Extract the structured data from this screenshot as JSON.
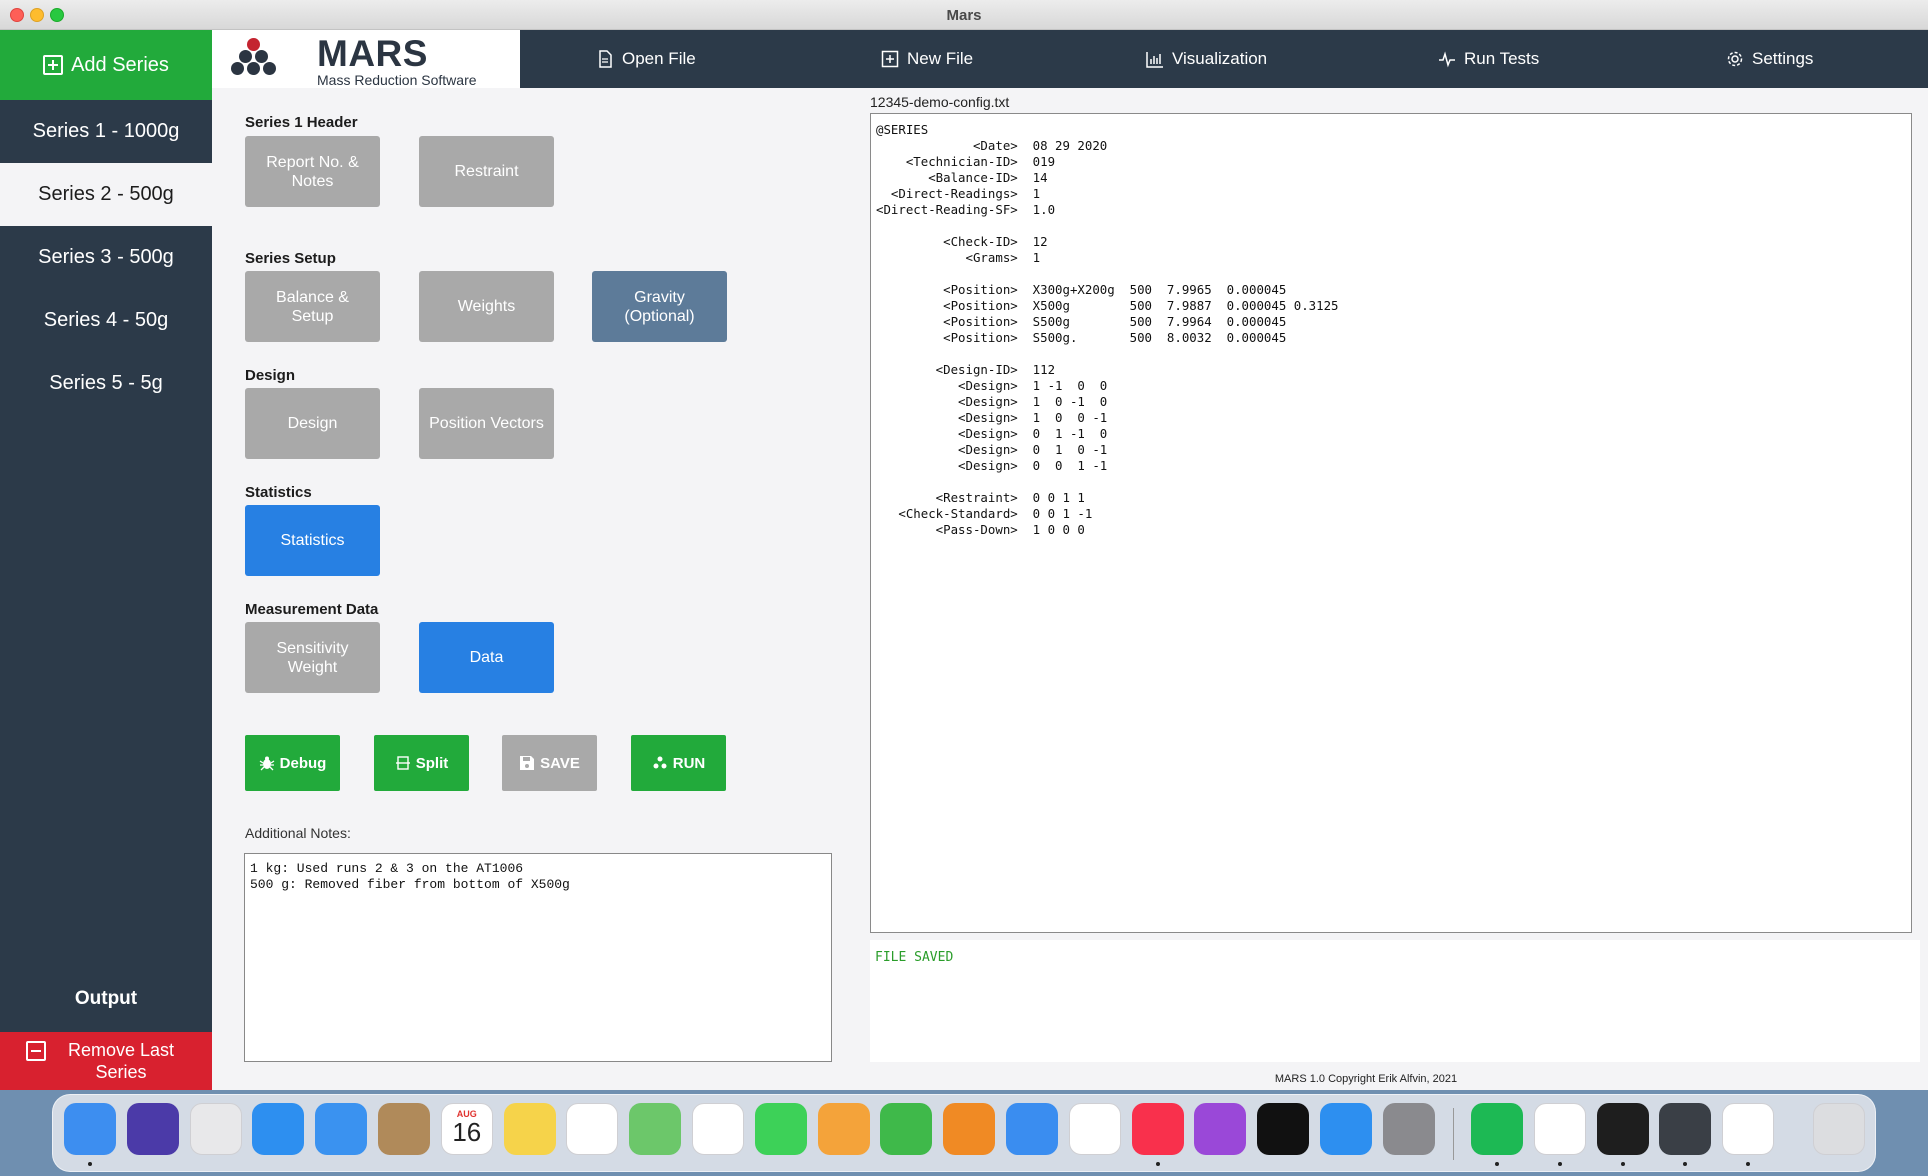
{
  "window": {
    "title": "Mars"
  },
  "sidebar": {
    "add_series_label": "Add Series",
    "items": [
      {
        "label": "Series 1 - 1000g",
        "active": false
      },
      {
        "label": "Series 2 - 500g",
        "active": true
      },
      {
        "label": "Series 3 - 500g",
        "active": false
      },
      {
        "label": "Series 4 - 50g",
        "active": false
      },
      {
        "label": "Series 5 - 5g",
        "active": false
      }
    ],
    "output_label": "Output",
    "remove_label": "Remove Last Series"
  },
  "logo": {
    "title": "MARS",
    "subtitle": "Mass Reduction Software"
  },
  "nav": {
    "open_file": "Open File",
    "new_file": "New File",
    "visualization": "Visualization",
    "run_tests": "Run Tests",
    "settings": "Settings"
  },
  "sections": {
    "header": {
      "title": "Series 1 Header",
      "report": "Report No. & Notes",
      "restraint": "Restraint"
    },
    "setup": {
      "title": "Series Setup",
      "balance": "Balance & Setup",
      "weights": "Weights",
      "gravity": "Gravity (Optional)"
    },
    "design": {
      "title": "Design",
      "design": "Design",
      "position_vectors": "Position Vectors"
    },
    "statistics": {
      "title": "Statistics",
      "statistics": "Statistics"
    },
    "measurement": {
      "title": "Measurement Data",
      "sensitivity": "Sensitivity Weight",
      "data": "Data"
    }
  },
  "actions": {
    "debug": "Debug",
    "split": "Split",
    "save": "SAVE",
    "run": "RUN"
  },
  "notes": {
    "label": "Additional Notes:",
    "text": "1 kg: Used runs 2 & 3 on the AT1006\n500 g: Removed fiber from bottom of X500g"
  },
  "editor": {
    "filename": "12345-demo-config.txt",
    "content": "@SERIES\n             <Date>  08 29 2020\n    <Technician-ID>  019\n       <Balance-ID>  14\n  <Direct-Readings>  1\n<Direct-Reading-SF>  1.0\n\n         <Check-ID>  12\n            <Grams>  1\n\n         <Position>  X300g+X200g  500  7.9965  0.000045\n         <Position>  X500g        500  7.9887  0.000045 0.3125\n         <Position>  S500g        500  7.9964  0.000045\n         <Position>  S500g.       500  8.0032  0.000045\n\n        <Design-ID>  112\n           <Design>  1 -1  0  0\n           <Design>  1  0 -1  0\n           <Design>  1  0  0 -1\n           <Design>  0  1 -1  0\n           <Design>  0  1  0 -1\n           <Design>  0  0  1 -1\n\n        <Restraint>  0 0 1 1\n   <Check-Standard>  0 0 1 -1\n        <Pass-Down>  1 0 0 0"
  },
  "console": {
    "text": "FILE SAVED"
  },
  "footer": {
    "copyright": "MARS 1.0 Copyright Erik Alfvin, 2021"
  },
  "calendar": {
    "month": "AUG",
    "day": "16"
  },
  "dock": {
    "icons": [
      {
        "name": "finder-icon",
        "color": "#3d8ef0",
        "running": true
      },
      {
        "name": "siri-icon",
        "color": "#4b3aa8",
        "running": false
      },
      {
        "name": "launchpad-icon",
        "color": "#e8e8ea",
        "running": false
      },
      {
        "name": "safari-icon",
        "color": "#2d8ff0",
        "running": false
      },
      {
        "name": "mail-icon",
        "color": "#3a92f0",
        "running": false
      },
      {
        "name": "contacts-icon",
        "color": "#b08a5a",
        "running": false
      },
      {
        "name": "calendar-icon",
        "color": "#ffffff",
        "running": false
      },
      {
        "name": "notes-icon",
        "color": "#f6d34a",
        "running": false
      },
      {
        "name": "reminders-icon",
        "color": "#ffffff",
        "running": false
      },
      {
        "name": "maps-icon",
        "color": "#6cc76a",
        "running": false
      },
      {
        "name": "photos-icon",
        "color": "#ffffff",
        "running": false
      },
      {
        "name": "messages-icon",
        "color": "#3dd158",
        "running": false
      },
      {
        "name": "pages-icon",
        "color": "#f4a33a",
        "running": false
      },
      {
        "name": "numbers-icon",
        "color": "#3fb94a",
        "running": false
      },
      {
        "name": "books-icon",
        "color": "#f08a24",
        "running": false
      },
      {
        "name": "keynote-icon",
        "color": "#3a8df0",
        "running": false
      },
      {
        "name": "news-icon",
        "color": "#ffffff",
        "running": false
      },
      {
        "name": "music-icon",
        "color": "#f9304c",
        "running": true
      },
      {
        "name": "podcasts-icon",
        "color": "#9a48d8",
        "running": false
      },
      {
        "name": "tv-icon",
        "color": "#111111",
        "running": false
      },
      {
        "name": "app-store-icon",
        "color": "#2d8ff0",
        "running": false
      },
      {
        "name": "system-preferences-icon",
        "color": "#8a8a8e",
        "running": false
      },
      {
        "name": "spotify-icon",
        "color": "#1db954",
        "running": true
      },
      {
        "name": "chrome-icon",
        "color": "#ffffff",
        "running": true
      },
      {
        "name": "terminal-icon",
        "color": "#1e1e1e",
        "running": true
      },
      {
        "name": "kivy-icon",
        "color": "#3a3f46",
        "running": true
      },
      {
        "name": "vscode-icon",
        "color": "#ffffff",
        "running": true
      },
      {
        "name": "trash-icon",
        "color": "#dcdde0",
        "running": false
      }
    ]
  }
}
